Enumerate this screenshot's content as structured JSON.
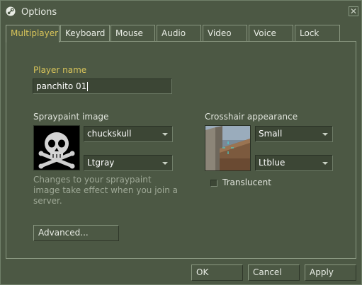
{
  "window": {
    "title": "Options",
    "title_icon": "steam-icon",
    "close_glyph": "✕"
  },
  "tabs": [
    {
      "label": "Multiplayer",
      "active": true
    },
    {
      "label": "Keyboard"
    },
    {
      "label": "Mouse"
    },
    {
      "label": "Audio"
    },
    {
      "label": "Video"
    },
    {
      "label": "Voice"
    },
    {
      "label": "Lock"
    }
  ],
  "multiplayer": {
    "player_name_label": "Player name",
    "player_name_value": "panchito 01",
    "spraypaint_label": "Spraypaint image",
    "spray_image_select": "chuckskull",
    "spray_color_select": "Ltgray",
    "spray_hint": [
      "Changes to your spraypaint",
      "image take effect when you join a",
      "server."
    ],
    "advanced_button": "Advanced...",
    "crosshair_label": "Crosshair appearance",
    "crosshair_size_select": "Small",
    "crosshair_color_select": "Ltblue",
    "translucent_label": "Translucent",
    "translucent_checked": false
  },
  "buttons": {
    "ok": "OK",
    "cancel": "Cancel",
    "apply": "Apply"
  },
  "colors": {
    "background": "#4c5844",
    "accent_text": "#d8c45a",
    "field_bg": "#3c4635",
    "border_light": "#8a9881"
  }
}
